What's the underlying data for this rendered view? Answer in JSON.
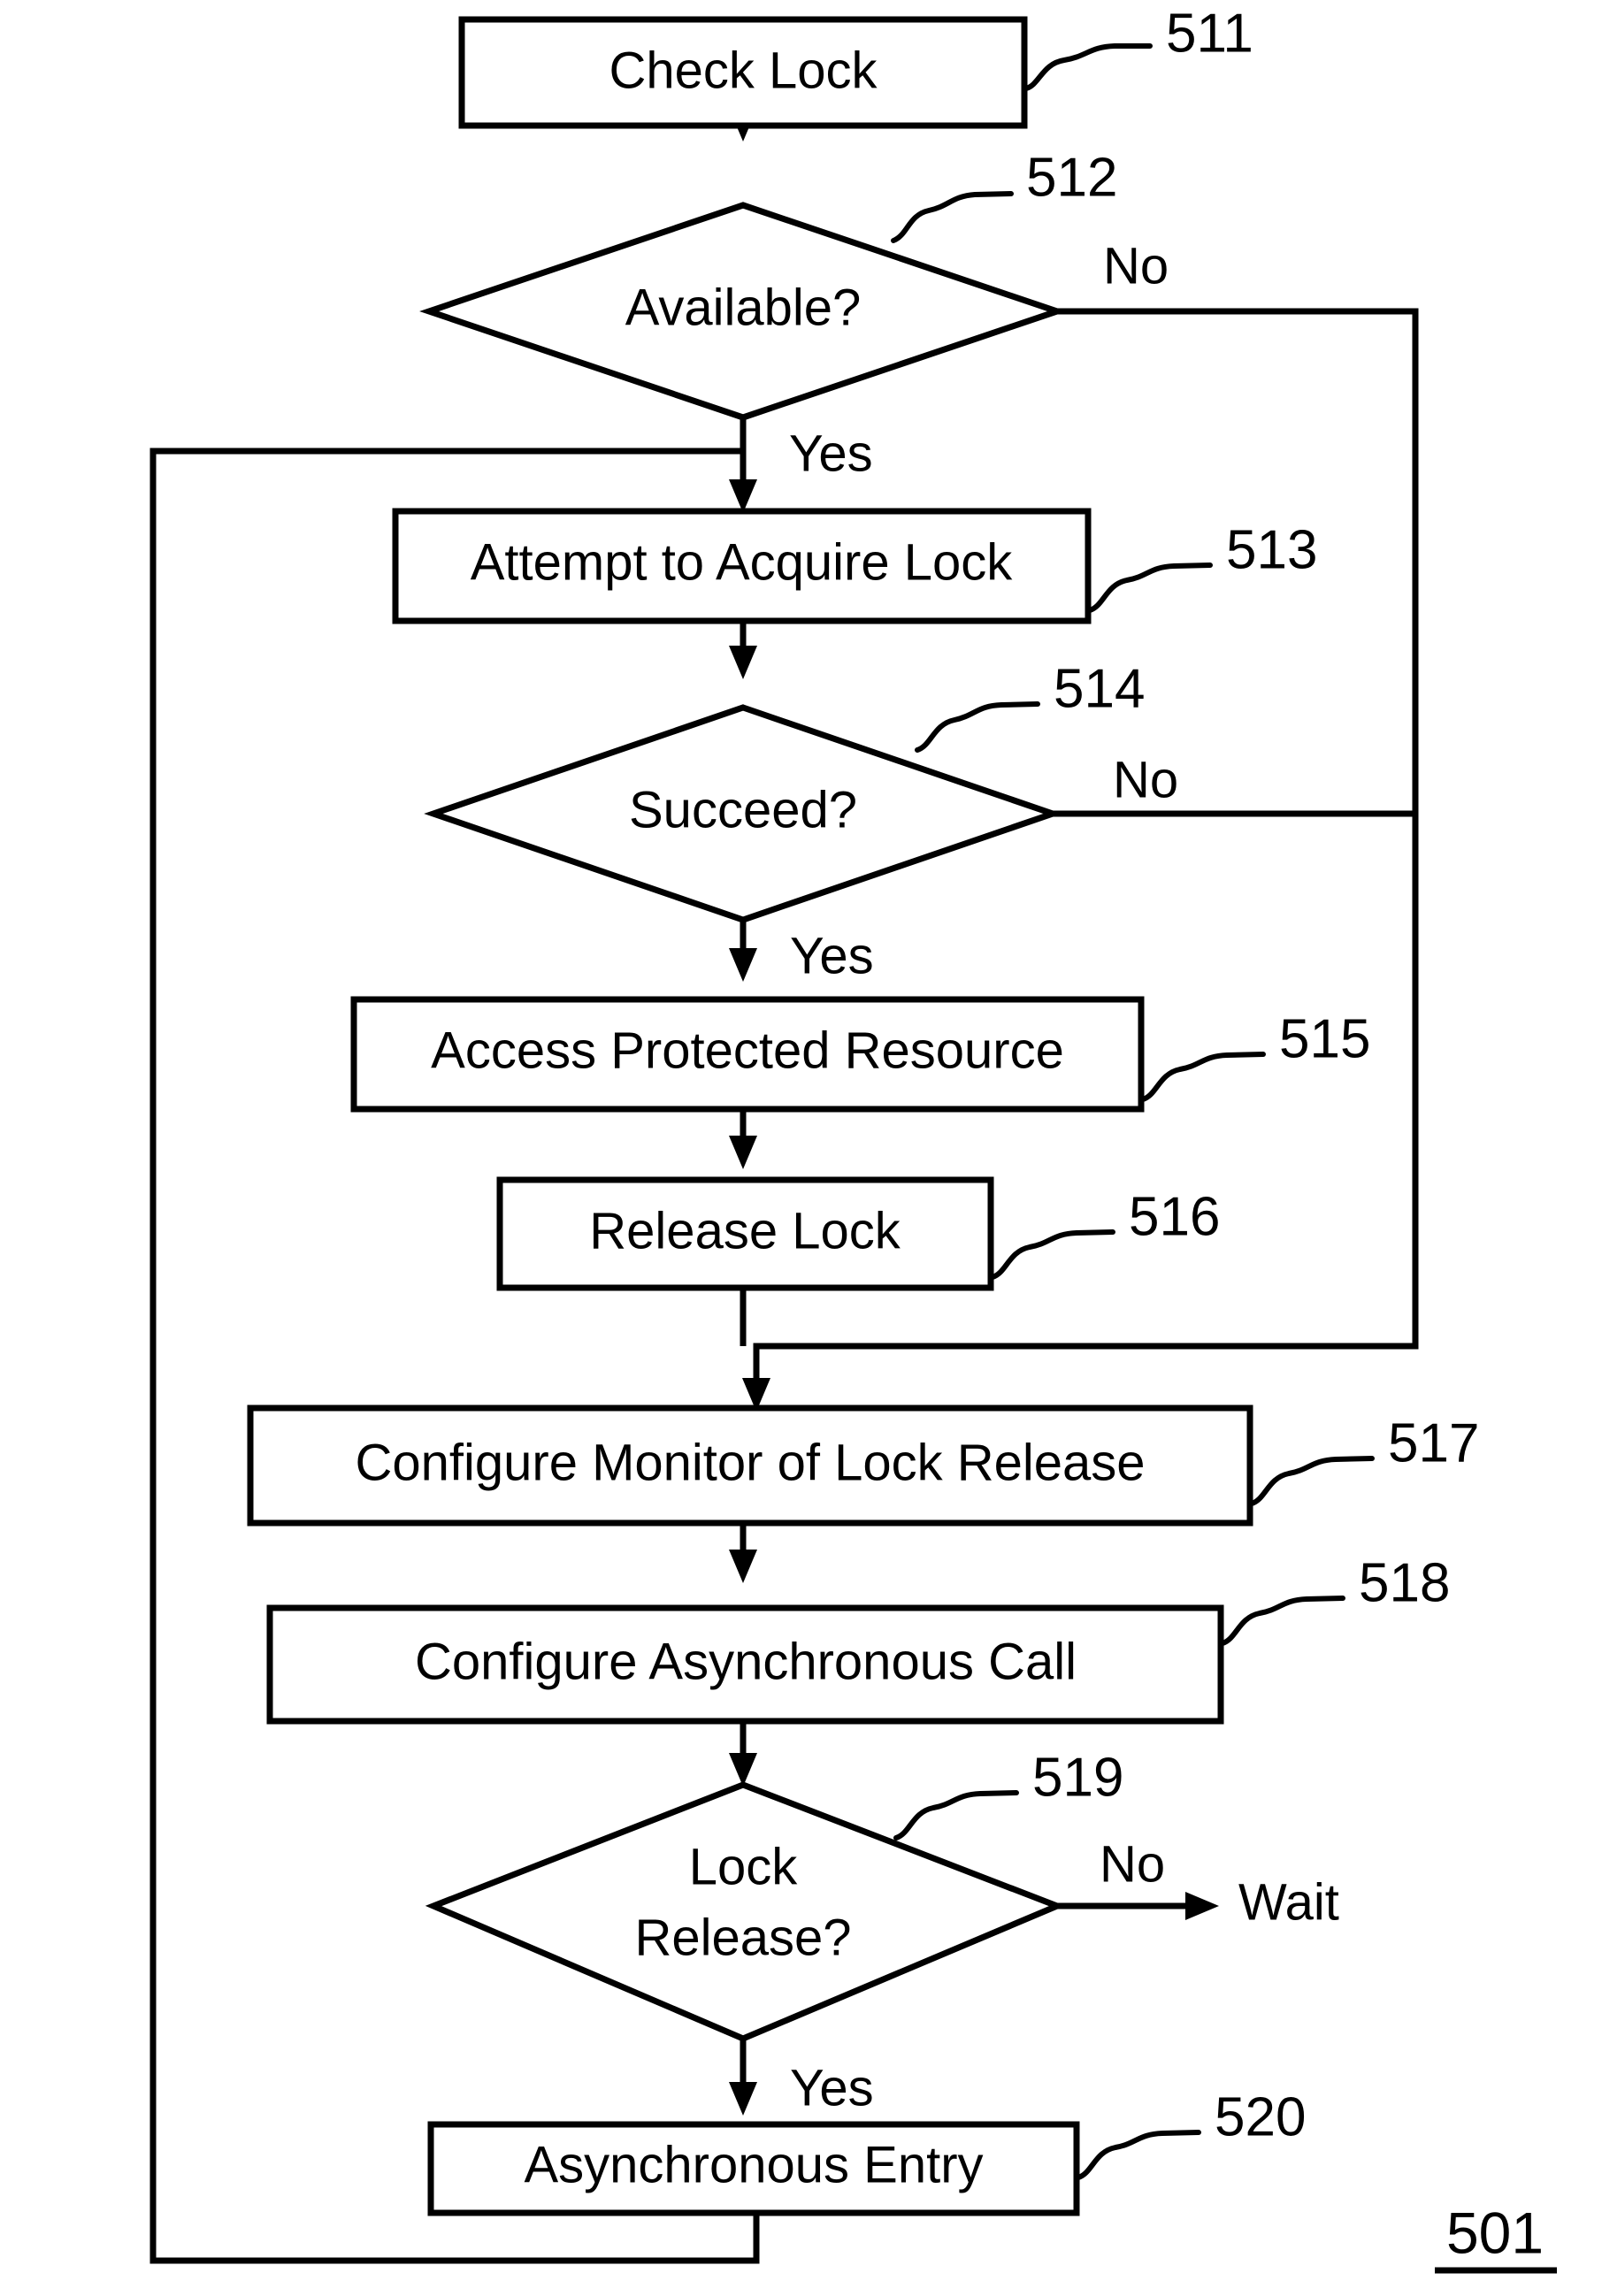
{
  "figure": {
    "number": "501",
    "title_text": "501"
  },
  "nodes": [
    {
      "id": "511",
      "ref": "511",
      "label": "Check Lock",
      "shape": "process"
    },
    {
      "id": "512",
      "ref": "512",
      "label": "Available?",
      "shape": "decision"
    },
    {
      "id": "513",
      "ref": "513",
      "label": "Attempt to Acquire Lock",
      "shape": "process"
    },
    {
      "id": "514",
      "ref": "514",
      "label": "Succeed?",
      "shape": "decision"
    },
    {
      "id": "515",
      "ref": "515",
      "label": "Access Protected Resource",
      "shape": "process"
    },
    {
      "id": "516",
      "ref": "516",
      "label": "Release Lock",
      "shape": "process"
    },
    {
      "id": "517",
      "ref": "517",
      "label": "Configure Monitor of Lock Release",
      "shape": "process"
    },
    {
      "id": "518",
      "ref": "518",
      "label": "Configure Asynchronous Call",
      "shape": "process"
    },
    {
      "id": "519",
      "ref": "519",
      "label_line1": "Lock",
      "label_line2": "Release?",
      "shape": "decision"
    },
    {
      "id": "520",
      "ref": "520",
      "label": "Asynchronous Entry",
      "shape": "process"
    }
  ],
  "edge_labels": {
    "available_no": "No",
    "available_yes": "Yes",
    "succeed_no": "No",
    "succeed_yes": "Yes",
    "lock_release_no": "No",
    "lock_release_yes": "Yes"
  },
  "terminals": {
    "wait": "Wait"
  },
  "colors": {
    "line": "#000000",
    "fill": "#ffffff",
    "background": "#ffffff"
  }
}
